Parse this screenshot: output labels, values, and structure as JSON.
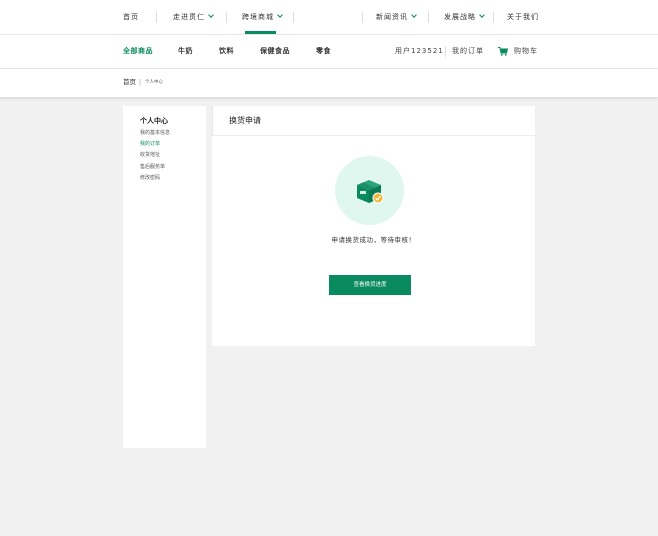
{
  "topnav": {
    "home": "首页",
    "about_yili": "走进贯仁",
    "cross_border_mall": "跨境商城",
    "news": "新闻资讯",
    "strategy": "发展战略",
    "contact": "关于我们"
  },
  "category_nav": {
    "items": [
      "全部商品",
      "牛奶",
      "饮料",
      "保健食品",
      "零食"
    ],
    "active_index": 0
  },
  "user_nav": {
    "username": "用户123521",
    "my_orders": "我的订单",
    "cart": "购物车"
  },
  "breadcrumb": {
    "home": "首页",
    "separator": "|",
    "current": "个人中心"
  },
  "sidebar": {
    "title": "个人中心",
    "links": [
      "我的基本信息",
      "我的订单",
      "收货地址",
      "售后服务单",
      "修改密码"
    ],
    "active_index": 1
  },
  "panel": {
    "title": "换货申请",
    "message": "申请换货成功，等待审核！",
    "button": "查看换货进度",
    "icon": "package-exchange-icon"
  },
  "colors": {
    "accent": "#0a8a5f",
    "icon_circle": "#dff7ee",
    "badge": "#f5b233",
    "background": "#f1f1f1"
  }
}
